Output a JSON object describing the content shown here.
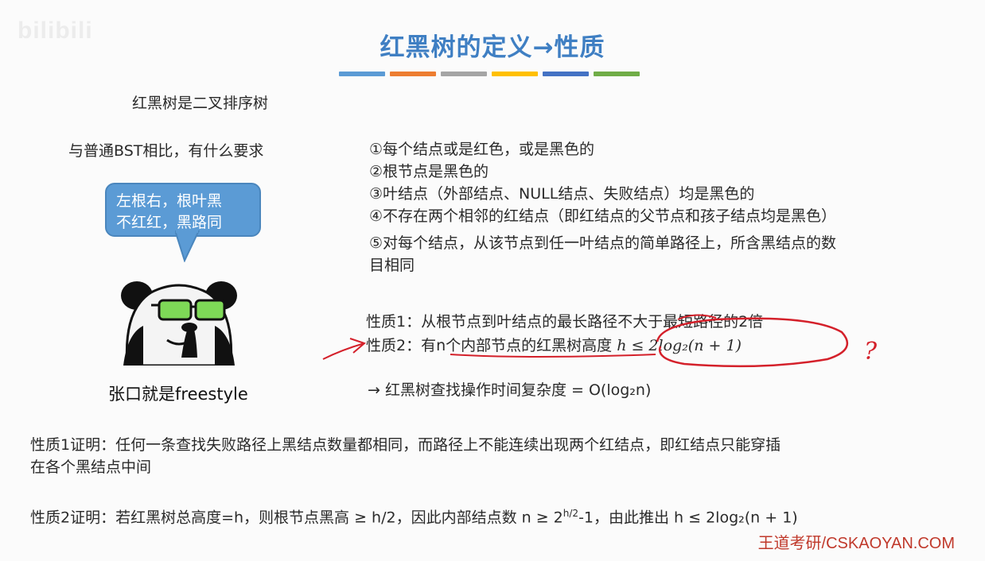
{
  "watermark": "bilibili",
  "title": "红黑树的定义→性质",
  "colorbar_colors": [
    "#5b9bd5",
    "#ed7d31",
    "#a5a5a5",
    "#ffc000",
    "#4472c4",
    "#70ad47"
  ],
  "left": {
    "line1": "红黑树是二叉排序树",
    "line2": "与普通BST相比，有什么要求",
    "bubble_line1": "左根右，根叶黑",
    "bubble_line2": "不红红，黑路同",
    "caption": "张口就是freestyle"
  },
  "rules": [
    "①每个结点或是红色，或是黑色的",
    "②根节点是黑色的",
    "③叶结点（外部结点、NULL结点、失败结点）均是黑色的",
    "④不存在两个相邻的红结点（即红结点的父节点和孩子结点均是黑色）",
    "⑤对每个结点，从该节点到任一叶结点的简单路径上，所含黑结点的数",
    "目相同"
  ],
  "properties": {
    "p1": "性质1：从根节点到叶结点的最长路径不大于最短路径的2倍",
    "p2_text": "性质2：有n个内部节点的红黑树高度",
    "p2_formula": "h ≤ 2log₂(n + 1)",
    "complexity": "→  红黑树查找操作时间复杂度 = O(log₂n)"
  },
  "annotation": {
    "question_mark": "?",
    "ink_color": "#d4202a"
  },
  "proofs": {
    "p1_line1": "性质1证明：任何一条查找失败路径上黑结点数量都相同，而路径上不能连续出现两个红结点，即红结点只能穿插",
    "p1_line2": "在各个黑结点中间",
    "p2_prefix": "性质2证明：若红黑树总高度=h，则根节点黑高 ≥ h/2，因此内部结点数 n ≥  2",
    "p2_sup": "h/2",
    "p2_suffix": "-1，由此推出 h ≤ 2log₂(n + 1)"
  },
  "footer": "王道考研/CSKAOYAN.COM"
}
